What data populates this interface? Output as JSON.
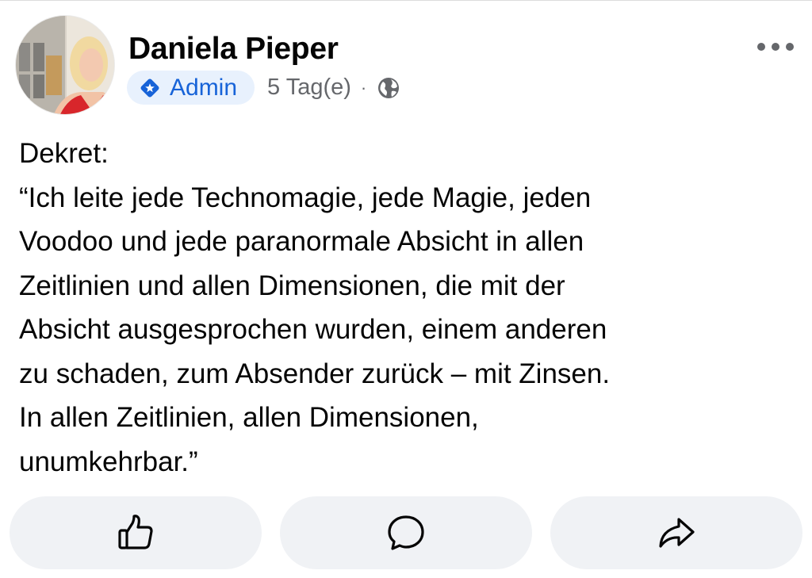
{
  "post": {
    "author": {
      "name": "Daniela Pieper",
      "avatar_icon": "avatar-photo"
    },
    "meta": {
      "badge_label": "Admin",
      "badge_icon": "admin-star-icon",
      "timestamp": "5 Tag(e)",
      "separator": "·",
      "audience_icon": "globe-icon"
    },
    "menu_icon": "more-options-icon",
    "body_lines": [
      "Dekret:",
      "“Ich leite jede Technomagie, jede Magie, jeden",
      "Voodoo und jede paranormale Absicht in allen",
      "Zeitlinien und allen Dimensionen, die mit der",
      "Absicht ausgesprochen wurden, einem anderen",
      "zu schaden, zum Absender zurück – mit Zinsen.",
      "In allen Zeitlinien, allen Dimensionen,",
      "unumkehrbar.”"
    ]
  },
  "actions": [
    {
      "icon": "thumbs-up-icon"
    },
    {
      "icon": "comment-icon"
    },
    {
      "icon": "share-icon"
    }
  ],
  "colors": {
    "badge_bg": "#e8f1fd",
    "badge_text": "#1763d8",
    "secondary_text": "#65676b",
    "button_bg": "#f0f2f5",
    "icon": "#050505"
  }
}
